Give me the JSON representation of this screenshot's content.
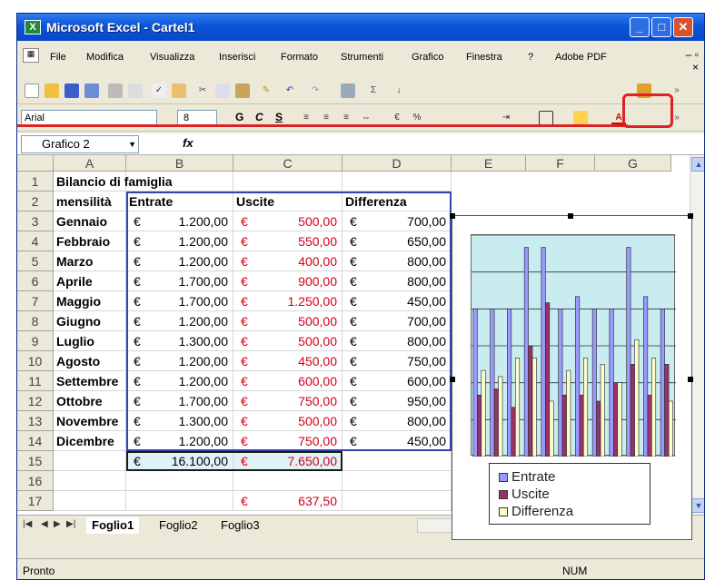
{
  "window": {
    "title": "Microsoft Excel - Cartel1",
    "app_icon": "excel-icon"
  },
  "menu": [
    "File",
    "Modifica",
    "Visualizza",
    "Inserisci",
    "Formato",
    "Strumenti",
    "Grafico",
    "Finestra",
    "?",
    "Adobe PDF"
  ],
  "menu_close": "×",
  "font": {
    "name": "Arial",
    "size": "8"
  },
  "format_buttons": [
    "G",
    "C",
    "S"
  ],
  "namebox": "Grafico 2",
  "fx": "fx",
  "columns": [
    "A",
    "B",
    "C",
    "D",
    "E",
    "F",
    "G"
  ],
  "rows": [
    "1",
    "2",
    "3",
    "4",
    "5",
    "6",
    "7",
    "8",
    "9",
    "10",
    "11",
    "12",
    "13",
    "14",
    "15",
    "16",
    "17"
  ],
  "sheet": {
    "title": "Bilancio di famiglia",
    "headers": [
      "mensilità",
      "Entrate",
      "Uscite",
      "Differenza"
    ],
    "currency": "€",
    "data": [
      [
        "Gennaio",
        "1.200,00",
        "500,00",
        "700,00"
      ],
      [
        "Febbraio",
        "1.200,00",
        "550,00",
        "650,00"
      ],
      [
        "Marzo",
        "1.200,00",
        "400,00",
        "800,00"
      ],
      [
        "Aprile",
        "1.700,00",
        "900,00",
        "800,00"
      ],
      [
        "Maggio",
        "1.700,00",
        "1.250,00",
        "450,00"
      ],
      [
        "Giugno",
        "1.200,00",
        "500,00",
        "700,00"
      ],
      [
        "Luglio",
        "1.300,00",
        "500,00",
        "800,00"
      ],
      [
        "Agosto",
        "1.200,00",
        "450,00",
        "750,00"
      ],
      [
        "Settembre",
        "1.200,00",
        "600,00",
        "600,00"
      ],
      [
        "Ottobre",
        "1.700,00",
        "750,00",
        "950,00"
      ],
      [
        "Novembre",
        "1.300,00",
        "500,00",
        "800,00"
      ],
      [
        "Dicembre",
        "1.200,00",
        "750,00",
        "450,00"
      ]
    ],
    "total_entrate": "16.100,00",
    "total_uscite": "7.650,00",
    "avg_uscite": "637,50"
  },
  "tabs": [
    "Foglio1",
    "Foglio2",
    "Foglio3"
  ],
  "status": {
    "left": "Pronto",
    "num": "NUM"
  },
  "colors": {
    "entrate": "#9999ff",
    "uscite": "#993366",
    "differenza": "#ffffcc",
    "plot_bg": "#ccecf1"
  },
  "chart_data": {
    "type": "bar",
    "categories": [
      "Gennaio",
      "Febbraio",
      "Marzo",
      "Aprile",
      "Maggio",
      "Giugno",
      "Luglio",
      "Agosto",
      "Settembre",
      "Ottobre",
      "Novembre",
      "Dicembre"
    ],
    "series": [
      {
        "name": "Entrate",
        "values": [
          1200,
          1200,
          1200,
          1700,
          1700,
          1200,
          1300,
          1200,
          1200,
          1700,
          1300,
          1200
        ]
      },
      {
        "name": "Uscite",
        "values": [
          500,
          550,
          400,
          900,
          1250,
          500,
          500,
          450,
          600,
          750,
          500,
          750
        ]
      },
      {
        "name": "Differenza",
        "values": [
          700,
          650,
          800,
          800,
          450,
          700,
          800,
          750,
          600,
          950,
          800,
          450
        ]
      }
    ],
    "ylim": [
      0,
      1800
    ],
    "legend": "bottom"
  }
}
